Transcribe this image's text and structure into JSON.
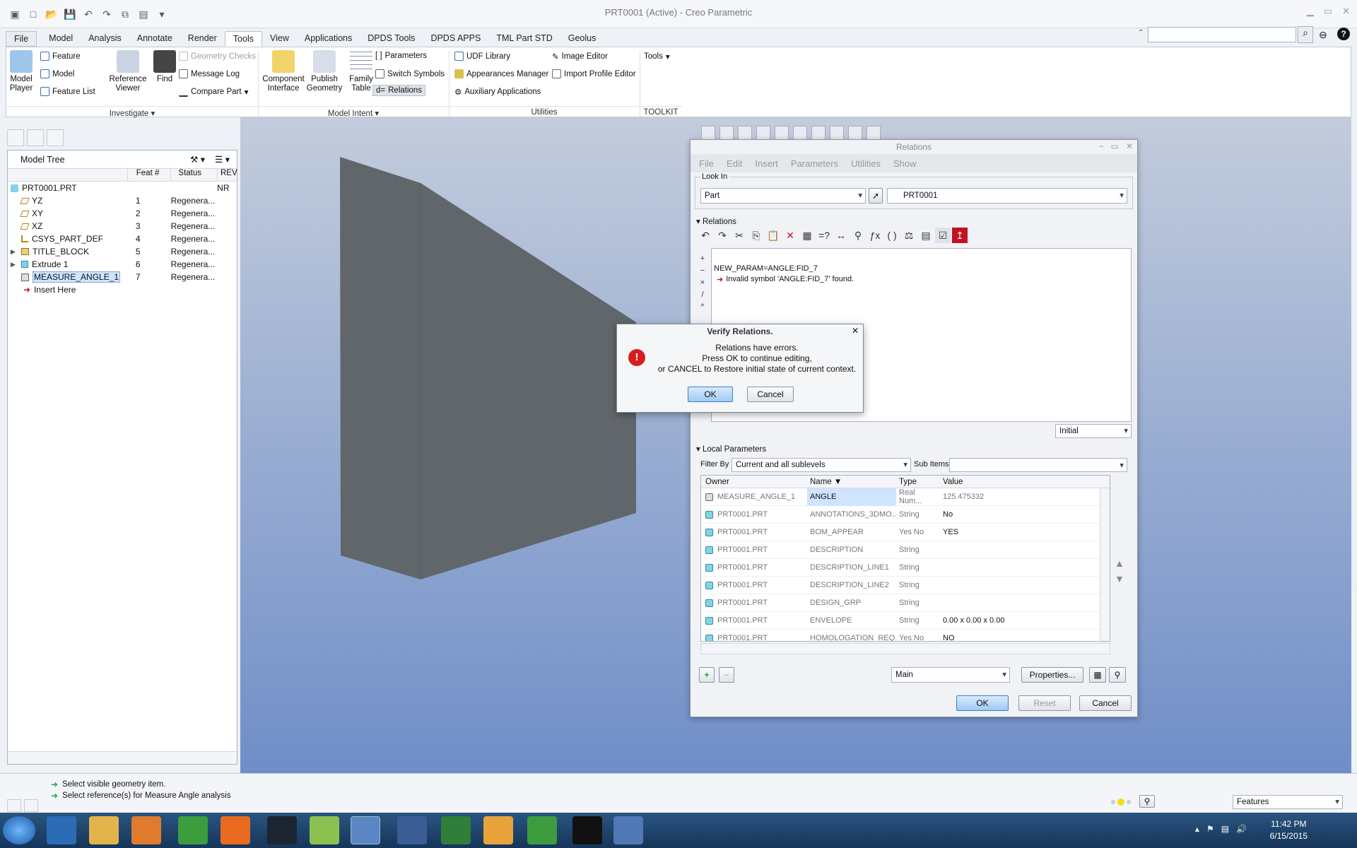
{
  "app": {
    "title": "PRT0001 (Active) - Creo Parametric"
  },
  "tabs": [
    "File",
    "Model",
    "Analysis",
    "Annotate",
    "Render",
    "Tools",
    "View",
    "Applications",
    "DPDS Tools",
    "DPDS APPS",
    "TML Part STD",
    "Geolus"
  ],
  "active_tab": "Tools",
  "ribbon": {
    "model_player": "Model Player",
    "feature": "Feature",
    "model": "Model",
    "feature_list": "Feature List",
    "reference_viewer": "Reference Viewer",
    "find": "Find",
    "geometry_checks": "Geometry Checks",
    "message_log": "Message Log",
    "compare_part": "Compare Part",
    "component_interface": "Component Interface",
    "publish_geometry": "Publish Geometry",
    "family_table": "Family Table",
    "parameters": "Parameters",
    "switch_symbols": "Switch Symbols",
    "relations": "Relations",
    "udf_library": "UDF Library",
    "appearances_manager": "Appearances Manager",
    "auxiliary_applications": "Auxiliary Applications",
    "image_editor": "Image Editor",
    "import_profile_editor": "Import Profile Editor",
    "tools": "Tools",
    "groups": {
      "investigate": "Investigate",
      "model_intent": "Model Intent",
      "utilities": "Utilities",
      "toolkit": "TOOLKIT"
    }
  },
  "model_tree": {
    "title": "Model Tree",
    "columns": [
      "Feat #",
      "Status",
      "REV"
    ],
    "root": {
      "name": "PRT0001.PRT",
      "rev": "NR"
    },
    "rows": [
      {
        "name": "YZ",
        "feat": "1",
        "status": "Regenera...",
        "icon": "datum-plane-icon"
      },
      {
        "name": "XY",
        "feat": "2",
        "status": "Regenera...",
        "icon": "datum-plane-icon"
      },
      {
        "name": "XZ",
        "feat": "3",
        "status": "Regenera...",
        "icon": "datum-plane-icon"
      },
      {
        "name": "CSYS_PART_DEF",
        "feat": "4",
        "status": "Regenera...",
        "icon": "csys-icon"
      },
      {
        "name": "TITLE_BLOCK",
        "feat": "5",
        "status": "Regenera...",
        "icon": "group-icon"
      },
      {
        "name": "Extrude 1",
        "feat": "6",
        "status": "Regenera...",
        "icon": "extrude-icon"
      },
      {
        "name": "MEASURE_ANGLE_1",
        "feat": "7",
        "status": "Regenera...",
        "icon": "measure-icon"
      }
    ],
    "insert_here": "Insert Here"
  },
  "relations": {
    "title": "Relations",
    "menu": [
      "File",
      "Edit",
      "Insert",
      "Parameters",
      "Utilities",
      "Show"
    ],
    "look_in_label": "Look In",
    "look_in_type": "Part",
    "look_in_value": "PRT0001",
    "section": "Relations",
    "code_line": "NEW_PARAM=ANGLE:FID_7",
    "error_line": "Invalid symbol 'ANGLE:FID_7' found.",
    "initial": "Initial",
    "local_params": "Local Parameters",
    "filter_by_label": "Filter By",
    "filter_by_value": "Current and all sublevels",
    "sub_items_label": "Sub Items",
    "columns": [
      "Owner",
      "Name",
      "Type",
      "Value"
    ],
    "params": [
      {
        "owner": "MEASURE_ANGLE_1",
        "name": "ANGLE",
        "type": "Real Num...",
        "value": "125.475332"
      },
      {
        "owner": "PRT0001.PRT",
        "name": "ANNOTATIONS_3DMO...",
        "type": "String",
        "value": "No"
      },
      {
        "owner": "PRT0001.PRT",
        "name": "BOM_APPEAR",
        "type": "Yes No",
        "value": "YES"
      },
      {
        "owner": "PRT0001.PRT",
        "name": "DESCRIPTION",
        "type": "String",
        "value": ""
      },
      {
        "owner": "PRT0001.PRT",
        "name": "DESCRIPTION_LINE1",
        "type": "String",
        "value": ""
      },
      {
        "owner": "PRT0001.PRT",
        "name": "DESCRIPTION_LINE2",
        "type": "String",
        "value": ""
      },
      {
        "owner": "PRT0001.PRT",
        "name": "DESIGN_GRP",
        "type": "String",
        "value": ""
      },
      {
        "owner": "PRT0001.PRT",
        "name": "ENVELOPE",
        "type": "String",
        "value": "0.00 x 0.00 x 0.00"
      },
      {
        "owner": "PRT0001.PRT",
        "name": "HOMOLOGATION_REQ...",
        "type": "Yes No",
        "value": "NO"
      }
    ],
    "main_combo": "Main",
    "properties": "Properties...",
    "ok": "OK",
    "reset": "Reset",
    "cancel": "Cancel"
  },
  "verify": {
    "title": "Verify Relations.",
    "line1": "Relations have errors.",
    "line2": "Press OK to continue editing,",
    "line3": "or CANCEL to Restore initial state of current context.",
    "ok": "OK",
    "cancel": "Cancel"
  },
  "status": {
    "msg1": "Select visible geometry item.",
    "msg2": "Select reference(s) for Measure Angle analysis",
    "filter": "Features"
  },
  "clock": {
    "time": "11:42 PM",
    "date": "6/15/2015"
  }
}
